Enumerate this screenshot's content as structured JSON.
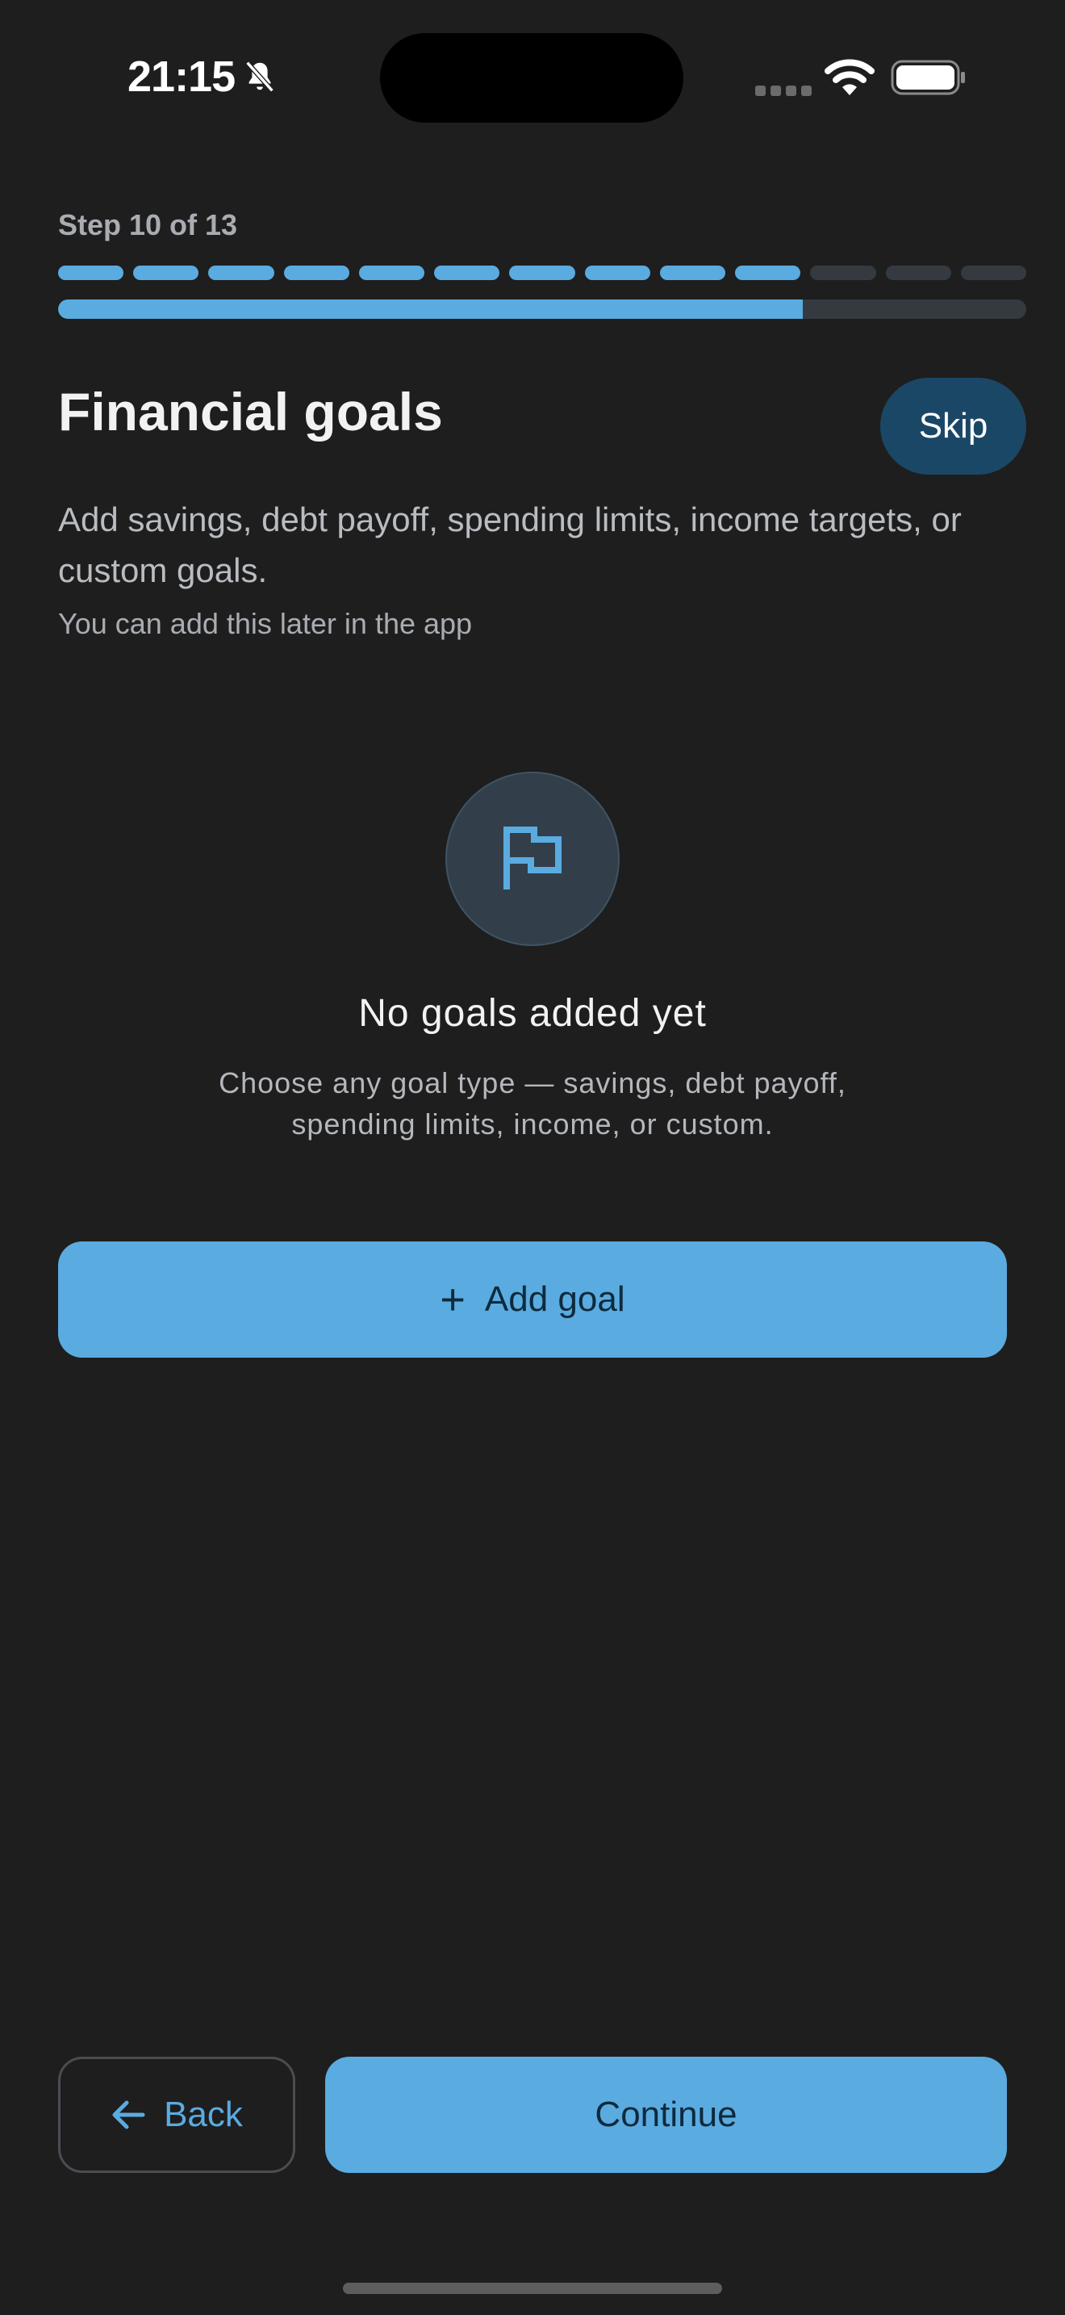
{
  "status_bar": {
    "time": "21:15",
    "icons": [
      "bell-slash-icon",
      "cellular-signal-icon",
      "wifi-icon",
      "battery-icon"
    ]
  },
  "step": {
    "label": "Step 10 of 13",
    "current": 10,
    "total": 13,
    "progress_fraction": 0.769
  },
  "header": {
    "title": "Financial goals",
    "skip_label": "Skip"
  },
  "description": "Add savings, debt payoff, spending limits, income targets, or custom goals.",
  "hint": "You can add this later in the app",
  "empty_state": {
    "icon": "flag-icon",
    "title": "No goals added yet",
    "text": "Choose any goal type — savings, debt payoff, spending limits, income, or custom."
  },
  "add_goal": {
    "icon": "plus-icon",
    "label": "Add goal"
  },
  "footer": {
    "back_label": "Back",
    "back_icon": "arrow-left-icon",
    "continue_label": "Continue"
  },
  "colors": {
    "background": "#1e1e1e",
    "accent": "#5aabe0",
    "skip_bg": "#1b4766",
    "track": "#353a40"
  }
}
